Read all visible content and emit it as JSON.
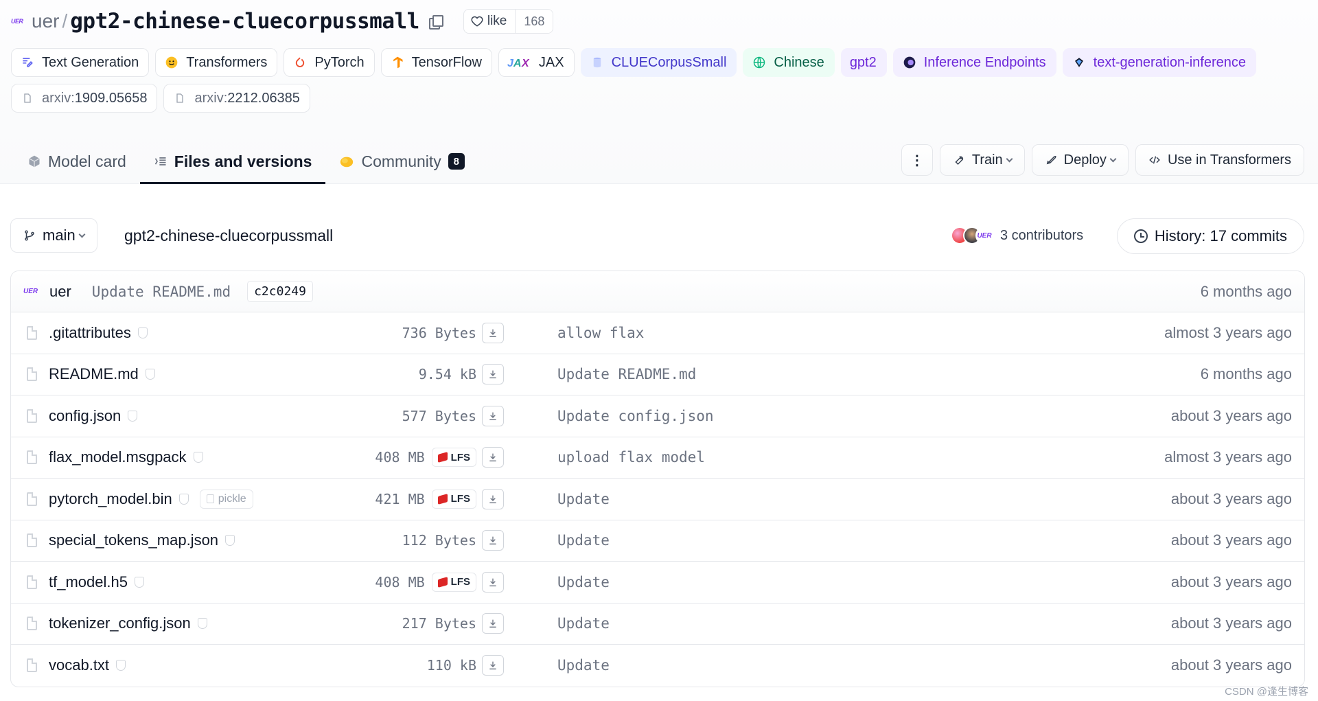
{
  "repo": {
    "org_logo": "UER",
    "org": "uer",
    "separator": "/",
    "name": "gpt2-chinese-cluecorpussmall",
    "like_label": "like",
    "like_count": "168"
  },
  "tags": [
    {
      "label": "Text Generation",
      "icon": "text-generation-icon",
      "kind": "task"
    },
    {
      "label": "Transformers",
      "icon": "hugging-face-icon",
      "kind": "lib"
    },
    {
      "label": "PyTorch",
      "icon": "pytorch-icon",
      "kind": "lib"
    },
    {
      "label": "TensorFlow",
      "icon": "tensorflow-icon",
      "kind": "lib"
    },
    {
      "label": "JAX",
      "icon": "jax-icon",
      "kind": "lib"
    },
    {
      "label": "CLUECorpusSmall",
      "icon": "dataset-icon",
      "kind": "dataset"
    },
    {
      "label": "Chinese",
      "icon": "globe-icon",
      "kind": "lang"
    },
    {
      "label": "gpt2",
      "icon": "",
      "kind": "other"
    },
    {
      "label": "Inference Endpoints",
      "icon": "inference-endpoints-icon",
      "kind": "other"
    },
    {
      "label": "text-generation-inference",
      "icon": "tgi-icon",
      "kind": "other"
    }
  ],
  "papers": [
    {
      "prefix": "arxiv:",
      "id": "1909.05658"
    },
    {
      "prefix": "arxiv:",
      "id": "2212.06385"
    }
  ],
  "tabs": [
    {
      "label": "Model card",
      "icon": "cube-icon"
    },
    {
      "label": "Files and versions",
      "icon": "files-icon",
      "active": true
    },
    {
      "label": "Community",
      "icon": "community-icon",
      "count": "8"
    }
  ],
  "actions": {
    "kebab": "⋮",
    "train": "Train",
    "deploy": "Deploy",
    "use": "Use in Transformers"
  },
  "branch": {
    "name": "main",
    "path": "gpt2-chinese-cluecorpussmall",
    "contributors": "3 contributors",
    "history": "History: 17 commits"
  },
  "last_commit": {
    "user": "uer",
    "message": "Update README.md",
    "hash": "c2c0249",
    "time": "6 months ago"
  },
  "files": [
    {
      "name": ".gitattributes",
      "size": "736 Bytes",
      "lfs": false,
      "pickle": false,
      "message": "allow flax",
      "time": "almost 3 years ago"
    },
    {
      "name": "README.md",
      "size": "9.54 kB",
      "lfs": false,
      "pickle": false,
      "message": "Update README.md",
      "time": "6 months ago"
    },
    {
      "name": "config.json",
      "size": "577 Bytes",
      "lfs": false,
      "pickle": false,
      "message": "Update config.json",
      "time": "about 3 years ago"
    },
    {
      "name": "flax_model.msgpack",
      "size": "408 MB",
      "lfs": true,
      "pickle": false,
      "message": "upload flax model",
      "time": "almost 3 years ago"
    },
    {
      "name": "pytorch_model.bin",
      "size": "421 MB",
      "lfs": true,
      "pickle": true,
      "message": "Update",
      "time": "about 3 years ago"
    },
    {
      "name": "special_tokens_map.json",
      "size": "112 Bytes",
      "lfs": false,
      "pickle": false,
      "message": "Update",
      "time": "about 3 years ago"
    },
    {
      "name": "tf_model.h5",
      "size": "408 MB",
      "lfs": true,
      "pickle": false,
      "message": "Update",
      "time": "about 3 years ago"
    },
    {
      "name": "tokenizer_config.json",
      "size": "217 Bytes",
      "lfs": false,
      "pickle": false,
      "message": "Update",
      "time": "about 3 years ago"
    },
    {
      "name": "vocab.txt",
      "size": "110 kB",
      "lfs": false,
      "pickle": false,
      "message": "Update",
      "time": "about 3 years ago"
    }
  ],
  "labels": {
    "lfs": "LFS",
    "pickle": "pickle"
  },
  "watermark": "CSDN @逢生博客",
  "colors": {
    "accent_purple": "#6d28d9",
    "dataset_blue": "#4338ca",
    "lang_green": "#065f46",
    "lfs_red": "#dc2626"
  }
}
